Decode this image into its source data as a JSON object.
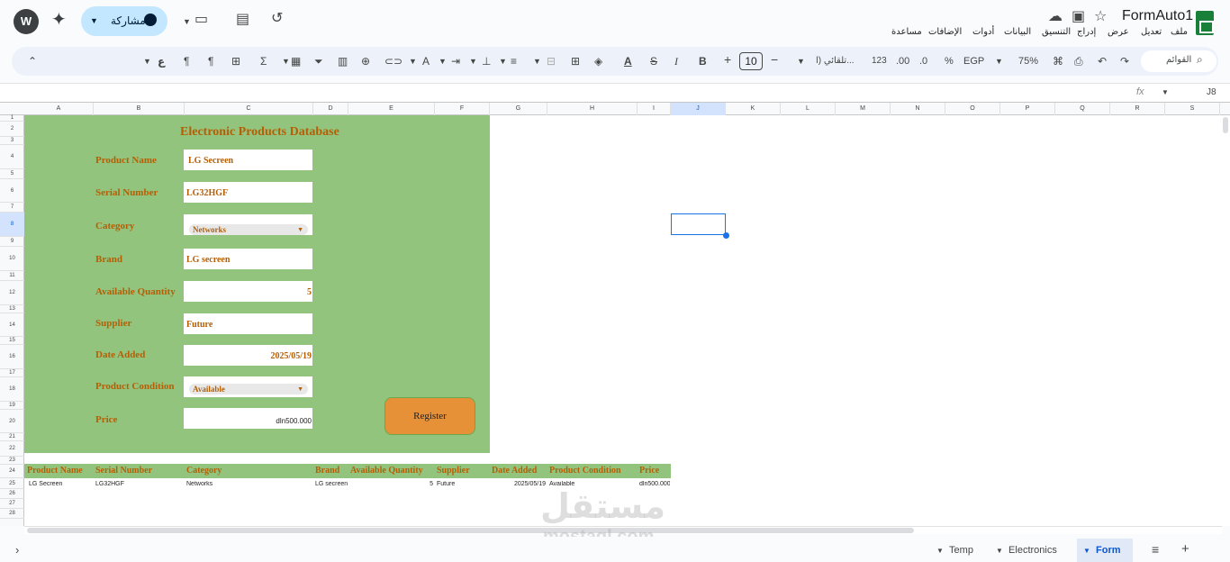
{
  "topbar": {
    "avatar": "W",
    "share_label": "مشاركة",
    "doc_title": "FormAuto1",
    "menus": [
      "ملف",
      "تعديل",
      "عرض",
      "إدراج",
      "التنسيق",
      "البيانات",
      "أدوات",
      "الإضافات",
      "مساعدة"
    ]
  },
  "toolbar": {
    "search_placeholder": "القوائم",
    "zoom": "75%",
    "currency": "EGP",
    "percent": "%",
    "dec_dec": ".0",
    "inc_dec": ".00",
    "num_format": "123",
    "font": "تلقائي (ا...",
    "font_size": "10",
    "bold": "B",
    "italic": "I",
    "strike": "S",
    "sigma": "Σ"
  },
  "formula_bar": {
    "cell_ref": "J8",
    "fx": "fx"
  },
  "columns": [
    "A",
    "B",
    "C",
    "D",
    "E",
    "F",
    "G",
    "H",
    "I",
    "J",
    "K",
    "L",
    "M",
    "N",
    "O",
    "P",
    "Q",
    "R",
    "S"
  ],
  "rows": [
    "1",
    "2",
    "3",
    "4",
    "5",
    "6",
    "7",
    "8",
    "9",
    "10",
    "11",
    "12",
    "13",
    "14",
    "15",
    "16",
    "17",
    "18",
    "19",
    "20",
    "21",
    "22",
    "23",
    "24",
    "25",
    "26",
    "27",
    "28"
  ],
  "form": {
    "title": "Electronic Products Database",
    "fields": [
      {
        "label": "Product Name",
        "value": "LG Secreen"
      },
      {
        "label": "Serial Number",
        "value": "LG32HGF"
      },
      {
        "label": "Category",
        "value": "Networks"
      },
      {
        "label": "Brand",
        "value": "LG secreen"
      },
      {
        "label": "Available Quantity",
        "value": "5"
      },
      {
        "label": "Supplier",
        "value": "Future"
      },
      {
        "label": "Date Added",
        "value": "2025/05/19"
      },
      {
        "label": "Product Condition",
        "value": "Available"
      },
      {
        "label": "Price",
        "value": "dln500.000"
      }
    ],
    "register_label": "Register"
  },
  "table": {
    "headers": [
      "Product Name",
      "Serial Number",
      "Category",
      "Brand",
      "Available Quantity",
      "Supplier",
      "Date Added",
      "Product Condition",
      "Price"
    ],
    "row": [
      "LG Secreen",
      "LG32HGF",
      "Networks",
      "LG secreen",
      "5",
      "Future",
      "2025/05/19",
      "Available",
      "dln500.000"
    ]
  },
  "sheets": {
    "tabs": [
      "Temp",
      "Electronics",
      "Form"
    ],
    "active": "Form"
  },
  "watermark": {
    "line1": "مستقل",
    "line2": "mostaql.com"
  }
}
